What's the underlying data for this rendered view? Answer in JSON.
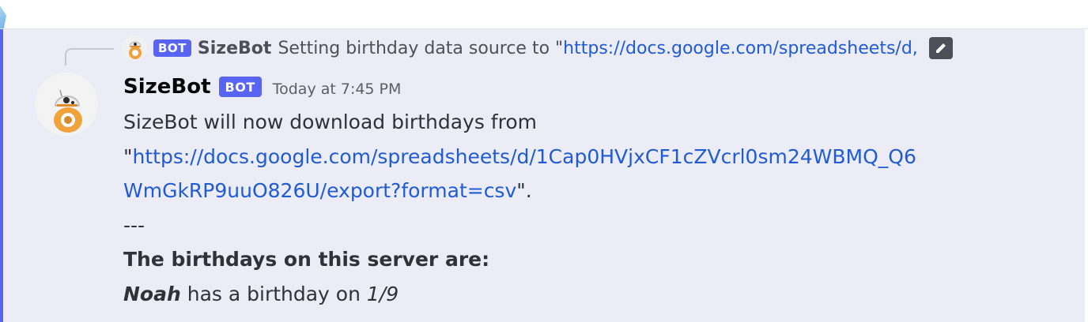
{
  "reply": {
    "bot_tag": "BOT",
    "author": "SizeBot",
    "text": "Setting birthday data source to \"",
    "link_text": "https://docs.google.com/spreadsheets/d,"
  },
  "message": {
    "author": "SizeBot",
    "bot_tag": "BOT",
    "timestamp": "Today at 7:45 PM",
    "line1": "SizeBot will now download birthdays from",
    "line2_prefix": "\"",
    "link_part1": "https://docs.google.com/spreadsheets/d/1Cap0HVjxCF1cZVcrl0sm24WBMQ_Q6",
    "link_part2": "WmGkRP9uuO826U/export?format=csv",
    "line3_suffix": "\".",
    "separator": "---",
    "list_heading": "The birthdays on this server are:",
    "entries": [
      {
        "name": "Noah",
        "middle": " has a birthday on ",
        "date": "1/9"
      }
    ]
  },
  "colors": {
    "accent": "#5865f2",
    "link": "#1f5bd6",
    "highlight_bg": "#ebecf6"
  }
}
